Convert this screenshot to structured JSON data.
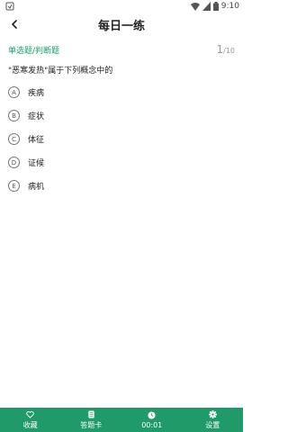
{
  "status_bar": {
    "time": "9:10",
    "icons": [
      "app-notification-icon",
      "wifi-icon",
      "signal-icon",
      "battery-icon"
    ]
  },
  "app_bar": {
    "back_icon": "back-arrow-icon",
    "title": "每日一练"
  },
  "question": {
    "type": "单选题/判断题",
    "current": "1",
    "total": "/10",
    "text": "\"恶寒发热\"属于下列概念中的",
    "options": [
      {
        "letter": "A",
        "text": "疾病"
      },
      {
        "letter": "B",
        "text": "症状"
      },
      {
        "letter": "C",
        "text": "体征"
      },
      {
        "letter": "D",
        "text": "证候"
      },
      {
        "letter": "E",
        "text": "病机"
      }
    ]
  },
  "bottom_bar": {
    "items": [
      {
        "icon": "heart-icon",
        "label": "收藏"
      },
      {
        "icon": "answer-card-icon",
        "label": "答题卡"
      },
      {
        "icon": "clock-icon",
        "label": "00:01"
      },
      {
        "icon": "gear-icon",
        "label": "设置"
      }
    ]
  },
  "colors": {
    "accent": "#1f9a68",
    "question_type": "#14a36b"
  }
}
